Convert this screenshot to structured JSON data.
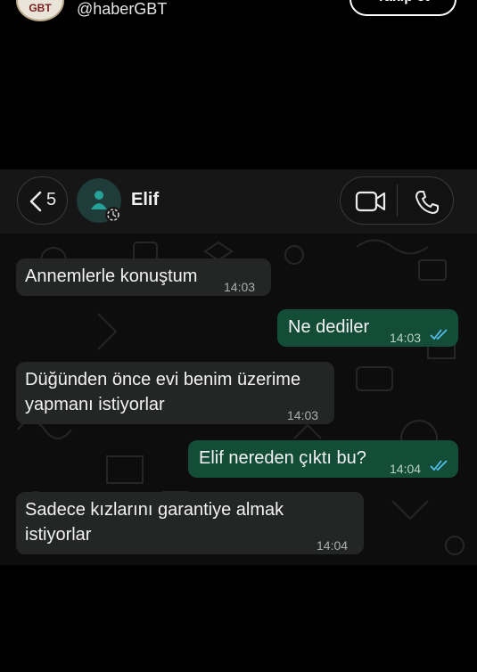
{
  "top": {
    "avatar_text": "GBT",
    "handle": "@haberGBT",
    "follow_label": "Takip et"
  },
  "chat_header": {
    "back_count": "5",
    "contact_name": "Elif",
    "icons": [
      "chevron-left-icon",
      "person-icon",
      "video-call-icon",
      "phone-icon"
    ]
  },
  "messages": [
    {
      "direction": "incoming",
      "text": "Annemlerle konuştum",
      "time": "14:03"
    },
    {
      "direction": "outgoing",
      "text": "Ne dediler",
      "time": "14:03",
      "read": true
    },
    {
      "direction": "incoming",
      "text": "Düğünden önce evi benim üzerime yapmanı istiyorlar",
      "time": "14:03"
    },
    {
      "direction": "outgoing",
      "text": "Elif nereden çıktı bu?",
      "time": "14:04",
      "read": true
    },
    {
      "direction": "incoming",
      "text": "Sadece kızlarını garantiye almak istiyorlar",
      "time": "14:04"
    }
  ],
  "colors": {
    "incoming_bubble": "#242626",
    "outgoing_bubble": "#144d37",
    "read_ticks": "#53bdeb",
    "background": "#000000"
  }
}
